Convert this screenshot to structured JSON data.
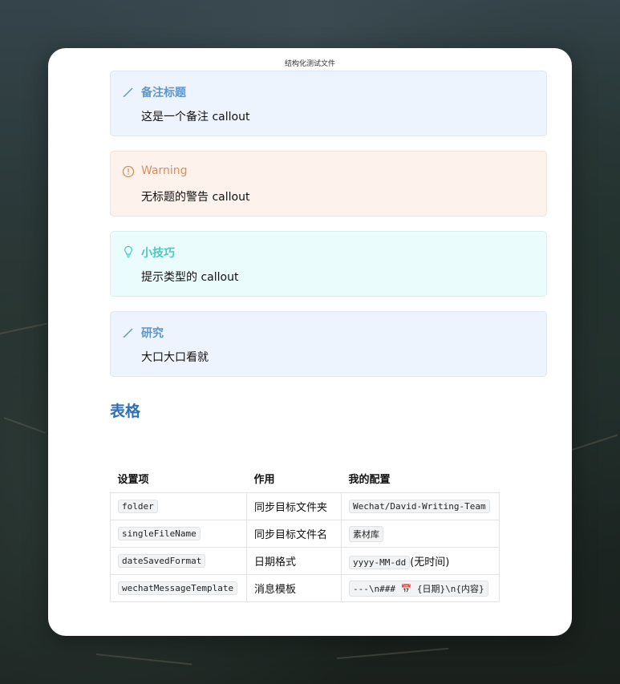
{
  "document": {
    "title": "结构化测试文件"
  },
  "callouts": [
    {
      "type": "note",
      "icon": "pencil-icon",
      "title": "备注标题",
      "body": "这是一个备注 callout"
    },
    {
      "type": "warning",
      "icon": "alert-circle-icon",
      "title": "Warning",
      "body": "无标题的警告 callout"
    },
    {
      "type": "tip",
      "icon": "lightbulb-icon",
      "title": "小技巧",
      "body": "提示类型的 callout"
    },
    {
      "type": "note",
      "icon": "pencil-icon",
      "title": "研究",
      "body": "大口大口看就"
    }
  ],
  "section": {
    "heading": "表格"
  },
  "table": {
    "headers": [
      "设置项",
      "作用",
      "我的配置"
    ],
    "rows": [
      {
        "key": "folder",
        "purpose": "同步目标文件夹",
        "value": "Wechat/David-Writing-Team",
        "suffix": ""
      },
      {
        "key": "singleFileName",
        "purpose": "同步目标文件名",
        "value": "素材库",
        "suffix": ""
      },
      {
        "key": "dateSavedFormat",
        "purpose": "日期格式",
        "value": "yyyy-MM-dd",
        "suffix": "(无时间)"
      },
      {
        "key": "wechatMessageTemplate",
        "purpose": "消息模板",
        "value": "---\\n### 📅 {日期}\\n{内容}",
        "suffix": ""
      }
    ]
  },
  "colors": {
    "note_accent": "#5c95cf",
    "warning_accent": "#d88f5c",
    "tip_accent": "#4cc7c2",
    "heading": "#2f6fb3"
  }
}
